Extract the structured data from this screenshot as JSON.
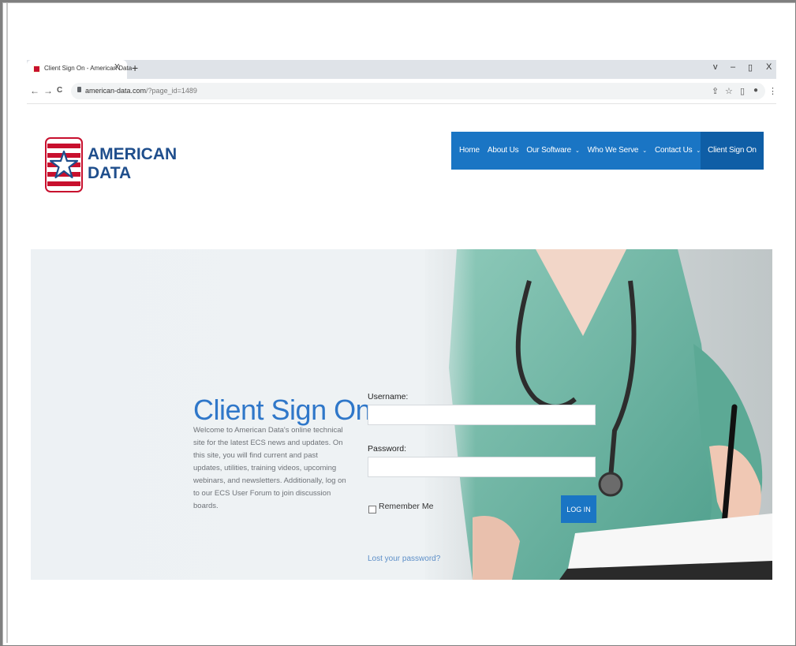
{
  "browser": {
    "tab_title": "Client Sign On - American Data",
    "tab_close": "X",
    "new_tab": "+",
    "window_controls": {
      "collapse": "v",
      "minimize": "–",
      "restore": "▯",
      "close": "X"
    },
    "nav": {
      "back": "←",
      "forward": "→",
      "reload": "C"
    },
    "url_host": "american-data.com",
    "url_path": "/?page_id=1489",
    "toolbar_icons": {
      "share": "⇪",
      "bookmark": "☆",
      "sidepanel": "▯",
      "profile": "●",
      "menu": "⋮"
    }
  },
  "site": {
    "brand_line1": "AMERICAN",
    "brand_line2": "DATA",
    "nav": [
      {
        "label": "Home",
        "has_dropdown": false
      },
      {
        "label": "About Us",
        "has_dropdown": false
      },
      {
        "label": "Our Software",
        "has_dropdown": true
      },
      {
        "label": "Who We Serve",
        "has_dropdown": true
      },
      {
        "label": "Contact Us",
        "has_dropdown": true
      },
      {
        "label": "Client Sign On",
        "has_dropdown": false,
        "active": true
      }
    ],
    "chevron": "⌄"
  },
  "hero": {
    "title": "Client Sign On",
    "description": "Welcome to American Data's online technical site for the latest ECS news and updates. On this site, you will find current and past updates, utilities, training videos, upcoming webinars, and newsletters. Additionally, log on to our ECS User Forum to join discussion boards."
  },
  "login_form": {
    "username_label": "Username:",
    "username_value": "",
    "password_label": "Password:",
    "password_value": "",
    "remember_label": "Remember Me",
    "remember_checked": false,
    "submit_label": "LOG IN",
    "lost_password_label": "Lost your password?"
  },
  "colors": {
    "accent": "#1a75c4",
    "title": "#2f77c9",
    "brand": "#1f4e8c",
    "logo_red": "#c8102e"
  }
}
